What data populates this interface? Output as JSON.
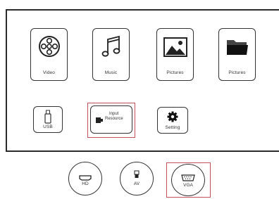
{
  "main_menu": {
    "tiles": [
      {
        "label": "Video",
        "icon": "film-reel-icon"
      },
      {
        "label": "Music",
        "icon": "music-note-icon"
      },
      {
        "label": "Pictures",
        "icon": "picture-icon"
      },
      {
        "label": "Pictures",
        "icon": "folder-icon"
      }
    ],
    "small_tiles": [
      {
        "label": "USB",
        "icon": "usb-drive-icon"
      },
      {
        "label": "Input Resource",
        "label_line1": "Input",
        "label_line2": "Resource",
        "icon": "hdmi-plug-icon",
        "selected": true
      },
      {
        "label": "Setting",
        "icon": "gear-icon"
      }
    ]
  },
  "input_sources": [
    {
      "label": "HD",
      "icon": "hdmi-port-icon"
    },
    {
      "label": "AV",
      "icon": "av-plug-icon"
    },
    {
      "label": "VGA",
      "icon": "vga-port-icon",
      "selected": true
    }
  ],
  "colors": {
    "selection": "#c0505a",
    "outline": "#333333",
    "background": "#ffffff"
  }
}
